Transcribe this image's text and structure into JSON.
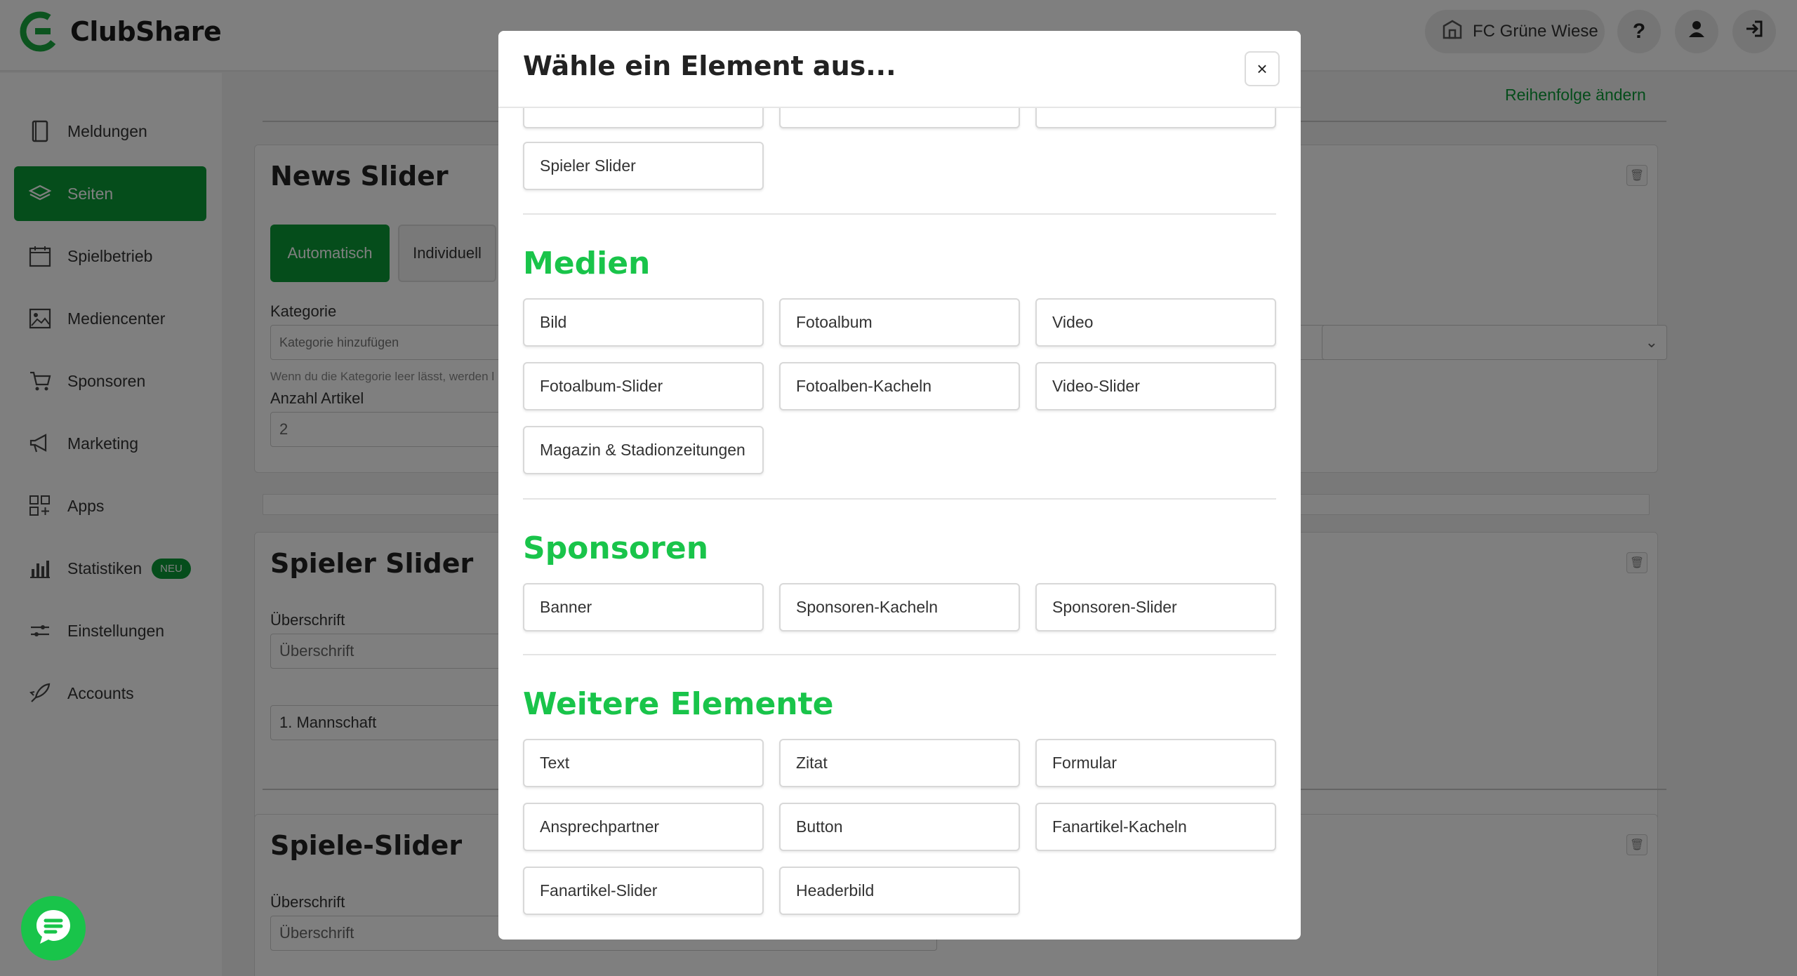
{
  "header": {
    "app_name": "ClubShare",
    "club_name": "FC Grüne Wiese",
    "help_label": "?"
  },
  "sidebar": {
    "items": [
      {
        "label": "Meldungen",
        "icon": "book-icon"
      },
      {
        "label": "Seiten",
        "icon": "layers-icon"
      },
      {
        "label": "Spielbetrieb",
        "icon": "calendar-icon"
      },
      {
        "label": "Mediencenter",
        "icon": "image-icon"
      },
      {
        "label": "Sponsoren",
        "icon": "cart-icon"
      },
      {
        "label": "Marketing",
        "icon": "megaphone-icon"
      },
      {
        "label": "Apps",
        "icon": "apps-grid-icon"
      },
      {
        "label": "Statistiken",
        "icon": "bar-chart-icon",
        "badge": "NEU"
      },
      {
        "label": "Einstellungen",
        "icon": "sliders-icon"
      },
      {
        "label": "Accounts",
        "icon": "rocket-icon"
      }
    ]
  },
  "main": {
    "reorder_link": "Reihenfolge ändern",
    "news_slider": {
      "title": "News Slider",
      "mode_auto": "Automatisch",
      "mode_individual": "Individuell",
      "category_label": "Kategorie",
      "category_placeholder": "Kategorie hinzufügen",
      "category_hint": "Wenn du die Kategorie leer lässt, werden l",
      "count_label": "Anzahl Artikel",
      "count_value": "2"
    },
    "spieler_slider": {
      "title": "Spieler Slider",
      "heading_label": "Überschrift",
      "heading_placeholder": "Überschrift",
      "team_value": "1. Mannschaft"
    },
    "spiele_slider": {
      "title": "Spiele-Slider",
      "heading_label": "Überschrift",
      "heading_placeholder": "Überschrift"
    }
  },
  "modal": {
    "title": "Wähle ein Element aus...",
    "close_label": "×",
    "top_item": "Spieler Slider",
    "sections": {
      "medien": {
        "title": "Medien",
        "items": [
          "Bild",
          "Fotoalbum",
          "Video",
          "Fotoalbum-Slider",
          "Fotoalben-Kacheln",
          "Video-Slider",
          "Magazin & Stadionzeitungen"
        ]
      },
      "sponsoren": {
        "title": "Sponsoren",
        "items": [
          "Banner",
          "Sponsoren-Kacheln",
          "Sponsoren-Slider"
        ]
      },
      "weitere": {
        "title": "Weitere Elemente",
        "items": [
          "Text",
          "Zitat",
          "Formular",
          "Ansprechpartner",
          "Button",
          "Fanartikel-Kacheln",
          "Fanartikel-Slider",
          "Headerbild"
        ]
      }
    }
  },
  "colors": {
    "brand_green": "#0a9a36",
    "section_green": "#19c44a"
  }
}
